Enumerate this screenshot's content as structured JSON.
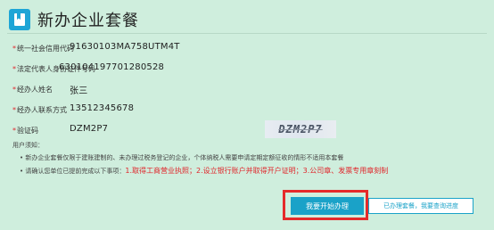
{
  "header": {
    "title": "新办企业套餐",
    "icon": "bookmark-icon",
    "icon_color": "#1ea5d6"
  },
  "form": {
    "rows": [
      {
        "label": "统一社会信用代码",
        "required": true,
        "value": "91630103MA758UTM4T"
      },
      {
        "label": "法定代表人身份证件号码",
        "required": true,
        "value": "630104197701280528"
      },
      {
        "label": "经办人姓名",
        "required": true,
        "value": "张三"
      },
      {
        "label": "经办人联系方式",
        "required": true,
        "value": "13512345678"
      },
      {
        "label": "验证码",
        "required": true,
        "value": "DZM2P7"
      }
    ],
    "captcha_text": "DZM2P7"
  },
  "notice": {
    "title": "用户须知：",
    "item1": "新办企业套餐仅限于建账建制的、未办理过税务登记的企业，个体纳税人需要申请定期定额征收的情形不适用本套餐",
    "item2_prefix": "请确认您单位已提前完成以下事项：",
    "item2_highlight": "1.取得工商营业执照；2.设立银行账户并取得开户证明；3.公司章、发票专用章刻制"
  },
  "actions": {
    "start_label": "我要开始办理",
    "query_label": "已办理套餐，我要查询进度"
  },
  "colors": {
    "accent": "#1aa2c8",
    "highlight_box": "#e52a2a",
    "background": "#cfeedd",
    "required": "#e0262b"
  }
}
